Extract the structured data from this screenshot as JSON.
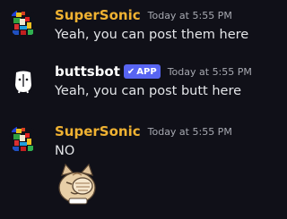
{
  "messages": [
    {
      "author": "SuperSonic",
      "author_color": "#f0b232",
      "timestamp": "Today at 5:55 PM",
      "text": "Yeah, you can post them here",
      "avatar_icon": "sonic-pixel-avatar"
    },
    {
      "author": "buttsbot",
      "author_color": "#ffffff",
      "badge": "APP",
      "badge_icon": "check-icon",
      "timestamp": "Today at 5:55 PM",
      "text": "Yeah, you can post butt here",
      "avatar_icon": "butt-bot-avatar"
    },
    {
      "author": "SuperSonic",
      "author_color": "#f0b232",
      "timestamp": "Today at 5:55 PM",
      "text": "NO",
      "avatar_icon": "sonic-pixel-avatar",
      "sticker_icon": "facepalm-cat-sticker"
    }
  ]
}
